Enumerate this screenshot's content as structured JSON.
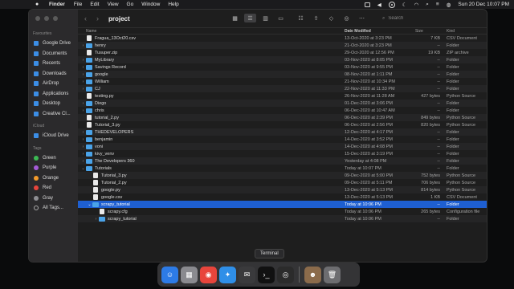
{
  "menubar": {
    "app_name": "Finder",
    "items": [
      "File",
      "Edit",
      "View",
      "Go",
      "Window",
      "Help"
    ],
    "datetime": "Sun 20 Dec  10:07 PM"
  },
  "sidebar": {
    "favourites_header": "Favourites",
    "favourites": [
      "Google Drive",
      "Documents",
      "Recents",
      "Downloads",
      "AirDrop",
      "Applications",
      "Desktop",
      "Creative Cl..."
    ],
    "icloud_header": "iCloud",
    "icloud": [
      "iCloud Drive"
    ],
    "tags_header": "Tags",
    "tags": [
      {
        "label": "Green",
        "color": "#3cba54"
      },
      {
        "label": "Purple",
        "color": "#a55bd8"
      },
      {
        "label": "Orange",
        "color": "#f39a2b"
      },
      {
        "label": "Red",
        "color": "#e8453c"
      },
      {
        "label": "Gray",
        "color": "#8e8e93"
      },
      {
        "label": "All Tags...",
        "color": ""
      }
    ]
  },
  "toolbar": {
    "back": "‹",
    "forward": "›",
    "title": "project",
    "search_placeholder": "Search"
  },
  "columns": {
    "name": "Name",
    "date": "Date Modified",
    "size": "Size",
    "kind": "Kind"
  },
  "files": [
    {
      "name": "Fragua_13Oct20.csv",
      "date": "13-Oct-2020 at 3:23 PM",
      "size": "7 KB",
      "kind": "CSV Document",
      "type": "file",
      "indent": 0,
      "disc": ""
    },
    {
      "name": "henry",
      "date": "21-Oct-2020 at 3:23 PM",
      "size": "--",
      "kind": "Folder",
      "type": "folder",
      "indent": 0,
      "disc": "›"
    },
    {
      "name": "Tusuper.zip",
      "date": "29-Oct-2020 at 12:56 PM",
      "size": "19 KB",
      "kind": "ZIP archive",
      "type": "file",
      "indent": 0,
      "disc": ""
    },
    {
      "name": "MyLibrary",
      "date": "03-Nov-2020 at 8:05 PM",
      "size": "--",
      "kind": "Folder",
      "type": "folder",
      "indent": 0,
      "disc": "›"
    },
    {
      "name": "Savings Record",
      "date": "03-Nov-2020 at 9:55 PM",
      "size": "--",
      "kind": "Folder",
      "type": "folder",
      "indent": 0,
      "disc": "›"
    },
    {
      "name": "google",
      "date": "08-Nov-2020 at 1:11 PM",
      "size": "--",
      "kind": "Folder",
      "type": "folder",
      "indent": 0,
      "disc": "›"
    },
    {
      "name": "William",
      "date": "21-Nov-2020 at 10:34 PM",
      "size": "--",
      "kind": "Folder",
      "type": "folder",
      "indent": 0,
      "disc": "›"
    },
    {
      "name": "CJ",
      "date": "22-Nov-2020 at 11:33 PM",
      "size": "--",
      "kind": "Folder",
      "type": "folder",
      "indent": 0,
      "disc": "›"
    },
    {
      "name": "testing.py",
      "date": "26-Nov-2020 at 11:28 AM",
      "size": "427 bytes",
      "kind": "Python Source",
      "type": "file",
      "indent": 0,
      "disc": ""
    },
    {
      "name": "Diego",
      "date": "01-Dec-2020 at 3:06 PM",
      "size": "--",
      "kind": "Folder",
      "type": "folder",
      "indent": 0,
      "disc": "›"
    },
    {
      "name": "chris",
      "date": "06-Dec-2020 at 10:47 AM",
      "size": "--",
      "kind": "Folder",
      "type": "folder",
      "indent": 0,
      "disc": "›"
    },
    {
      "name": "tutorial_2.py",
      "date": "06-Dec-2020 at 2:39 PM",
      "size": "849 bytes",
      "kind": "Python Source",
      "type": "file",
      "indent": 0,
      "disc": ""
    },
    {
      "name": "Tutorial_3.py",
      "date": "06-Dec-2020 at 2:56 PM",
      "size": "820 bytes",
      "kind": "Python Source",
      "type": "file",
      "indent": 0,
      "disc": ""
    },
    {
      "name": "THEDEVELOPERS",
      "date": "12-Dec-2020 at 4:17 PM",
      "size": "--",
      "kind": "Folder",
      "type": "folder",
      "indent": 0,
      "disc": "›"
    },
    {
      "name": "benjamin",
      "date": "14-Dec-2020 at 3:52 PM",
      "size": "--",
      "kind": "Folder",
      "type": "folder",
      "indent": 0,
      "disc": "›"
    },
    {
      "name": "voni",
      "date": "14-Dec-2020 at 4:08 PM",
      "size": "--",
      "kind": "Folder",
      "type": "folder",
      "indent": 0,
      "disc": "›"
    },
    {
      "name": "kivy_venv",
      "date": "15-Dec-2020 at 3:19 PM",
      "size": "--",
      "kind": "Folder",
      "type": "folder",
      "indent": 0,
      "disc": "›"
    },
    {
      "name": "The Developers 360",
      "date": "Yesterday at 4:08 PM",
      "size": "--",
      "kind": "Folder",
      "type": "folder",
      "indent": 0,
      "disc": "›"
    },
    {
      "name": "Tutorials",
      "date": "Today at 10:07 PM",
      "size": "--",
      "kind": "Folder",
      "type": "folder",
      "indent": 0,
      "disc": "⌄"
    },
    {
      "name": "Tutorial_3.py",
      "date": "09-Dec-2020 at 5:00 PM",
      "size": "752 bytes",
      "kind": "Python Source",
      "type": "file",
      "indent": 1,
      "disc": ""
    },
    {
      "name": "Tutorial_2.py",
      "date": "09-Dec-2020 at 5:11 PM",
      "size": "706 bytes",
      "kind": "Python Source",
      "type": "file",
      "indent": 1,
      "disc": ""
    },
    {
      "name": "google.py",
      "date": "13-Dec-2020 at 5:13 PM",
      "size": "814 bytes",
      "kind": "Python Source",
      "type": "file",
      "indent": 1,
      "disc": ""
    },
    {
      "name": "google.csv",
      "date": "13-Dec-2020 at 5:13 PM",
      "size": "1 KB",
      "kind": "CSV Document",
      "type": "file",
      "indent": 1,
      "disc": ""
    },
    {
      "name": "scrapy_tutorial",
      "date": "Today at 10:06 PM",
      "size": "--",
      "kind": "Folder",
      "type": "folder",
      "indent": 1,
      "disc": "⌄",
      "selected": true
    },
    {
      "name": "scrapy.cfg",
      "date": "Today at 10:06 PM",
      "size": "265 bytes",
      "kind": "Configuration file",
      "type": "file",
      "indent": 2,
      "disc": ""
    },
    {
      "name": "scrapy_tutorial",
      "date": "Today at 10:06 PM",
      "size": "--",
      "kind": "Folder",
      "type": "folder",
      "indent": 2,
      "disc": "›"
    }
  ],
  "tooltip": "Terminal",
  "dock": [
    {
      "name": "finder-icon",
      "color": "#2d7be6",
      "glyph": "☺"
    },
    {
      "name": "launchpad-icon",
      "color": "#8a8a8f",
      "glyph": "▦"
    },
    {
      "name": "chrome-icon",
      "color": "#e8453c",
      "glyph": "◉"
    },
    {
      "name": "safari-icon",
      "color": "#2f8fe8",
      "glyph": "✦"
    },
    {
      "name": "app-store-icon",
      "color": "#3a3a3c",
      "glyph": "✉"
    },
    {
      "name": "terminal-icon",
      "color": "#111111",
      "glyph": "›_"
    },
    {
      "name": "obs-icon",
      "color": "#2b2b2b",
      "glyph": "◎"
    },
    {
      "name": "photo-icon",
      "color": "#8b6b4b",
      "glyph": "☻"
    },
    {
      "name": "trash-icon",
      "color": "#6d6d70",
      "glyph": "🗑"
    }
  ]
}
